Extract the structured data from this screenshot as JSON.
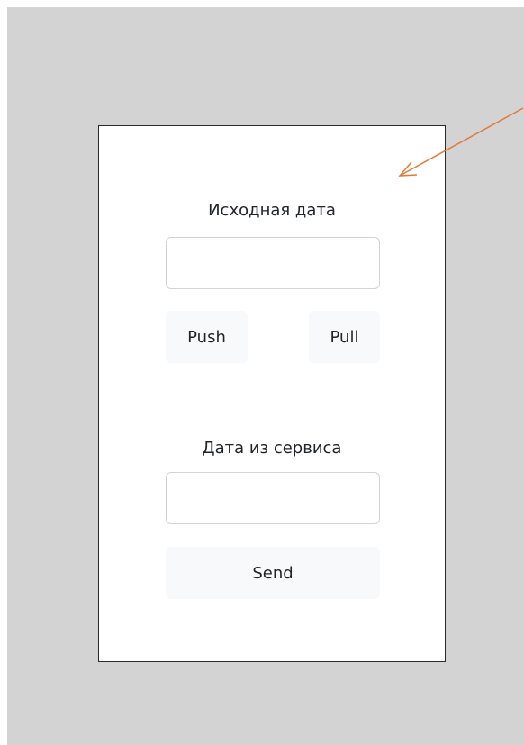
{
  "form": {
    "source_date_label": "Исходная дата",
    "source_date_value": "",
    "push_label": "Push",
    "pull_label": "Pull",
    "service_date_label": "Дата из сервиса",
    "service_date_value": "",
    "send_label": "Send"
  },
  "colors": {
    "background": "#d3d3d3",
    "panel": "#ffffff",
    "button": "#f8f9fa",
    "arrow": "#e07b39"
  },
  "annotation": {
    "icon": "arrow-annotation-icon"
  }
}
